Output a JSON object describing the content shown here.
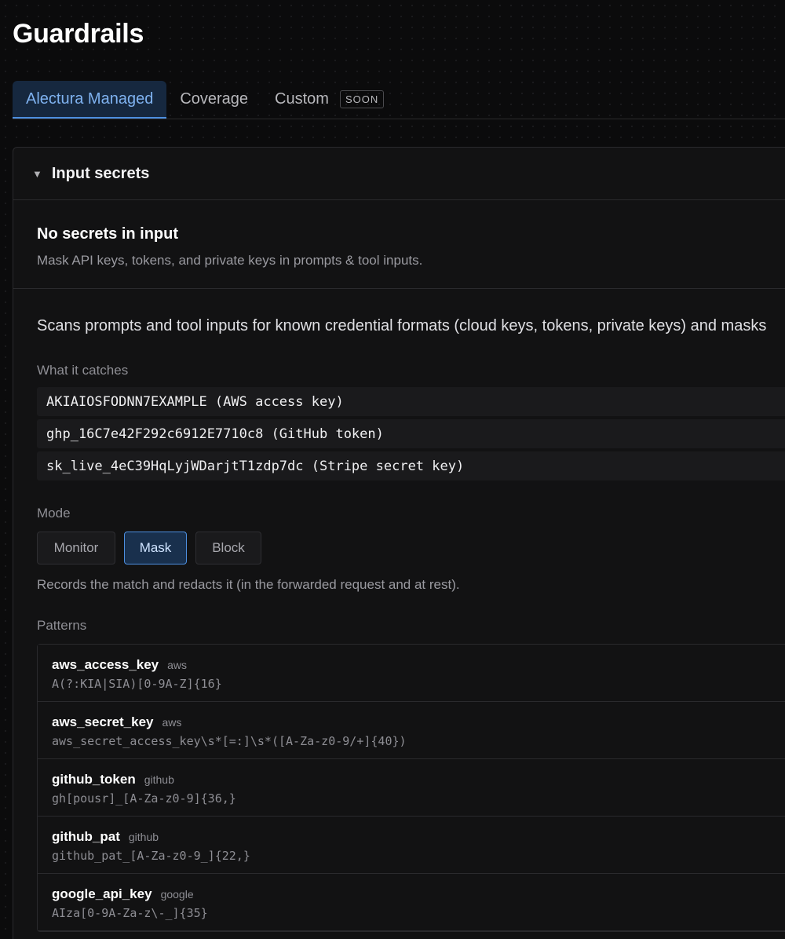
{
  "page": {
    "title": "Guardrails"
  },
  "tabs": [
    {
      "label": "Alectura Managed",
      "active": true
    },
    {
      "label": "Coverage",
      "active": false
    },
    {
      "label": "Custom",
      "active": false,
      "badge": "SOON"
    }
  ],
  "section": {
    "title": "Input secrets",
    "expanded": true,
    "summary_title": "No secrets in input",
    "summary_desc": "Mask API keys, tokens, and private keys in prompts & tool inputs.",
    "description": "Scans prompts and tool inputs for known credential formats (cloud keys, tokens, private keys) and masks",
    "catches_label": "What it catches",
    "catches": [
      "AKIAIOSFODNN7EXAMPLE (AWS access key)",
      "ghp_16C7e42F292c6912E7710c8 (GitHub token)",
      "sk_live_4eC39HqLyjWDarjtT1zdp7dc (Stripe secret key)"
    ],
    "mode_label": "Mode",
    "modes": [
      "Monitor",
      "Mask",
      "Block"
    ],
    "selected_mode": "Mask",
    "mode_desc": "Records the match and redacts it (in the forwarded request and at rest).",
    "patterns_label": "Patterns",
    "patterns": [
      {
        "name": "aws_access_key",
        "tag": "aws",
        "regex": "A(?:KIA|SIA)[0-9A-Z]{16}"
      },
      {
        "name": "aws_secret_key",
        "tag": "aws",
        "regex": "aws_secret_access_key\\s*[=:]\\s*([A-Za-z0-9/+]{40})"
      },
      {
        "name": "github_token",
        "tag": "github",
        "regex": "gh[pousr]_[A-Za-z0-9]{36,}"
      },
      {
        "name": "github_pat",
        "tag": "github",
        "regex": "github_pat_[A-Za-z0-9_]{22,}"
      },
      {
        "name": "google_api_key",
        "tag": "google",
        "regex": "AIza[0-9A-Za-z\\-_]{35}"
      }
    ]
  },
  "colors": {
    "accent": "#4d8fe0",
    "active_tab_bg": "#16283f",
    "background": "#0b0b0c"
  }
}
